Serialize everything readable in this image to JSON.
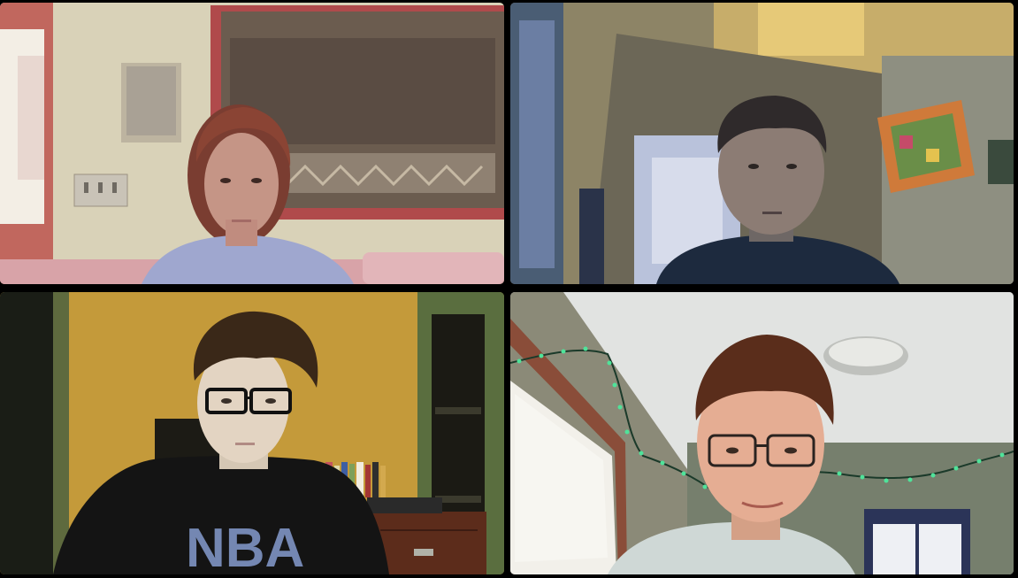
{
  "app": {
    "layout": "gallery-view-2x2",
    "background_color": "#000000"
  },
  "participants": [
    {
      "tile": "top-left",
      "scene": "living-room"
    },
    {
      "tile": "top-right",
      "scene": "room-pixelated-video"
    },
    {
      "tile": "bottom-left",
      "scene": "bedroom-yellow-wall"
    },
    {
      "tile": "bottom-right",
      "scene": "room-string-lights"
    }
  ],
  "shirt_text": {
    "bottom_left": "NBA"
  }
}
